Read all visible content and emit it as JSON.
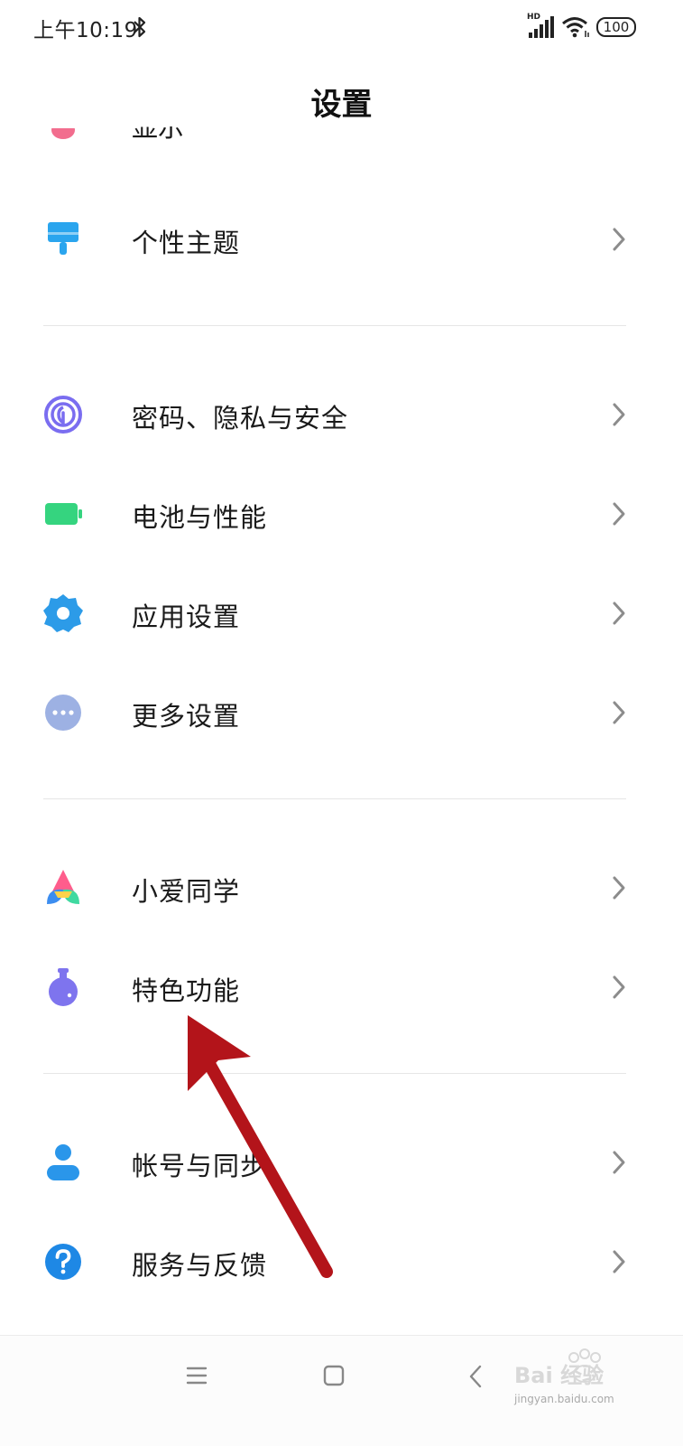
{
  "status_bar": {
    "time": "上午10:19",
    "network": "HD",
    "battery": "100"
  },
  "title": "设置",
  "partial_item": {
    "label": "显示"
  },
  "items": [
    {
      "label": "个性主题",
      "icon": "paintbrush-icon",
      "color": "#2aa5ee"
    },
    {
      "label": "密码、隐私与安全",
      "icon": "fingerprint-icon",
      "color": "#7a6df0"
    },
    {
      "label": "电池与性能",
      "icon": "battery-icon",
      "color": "#35d47f"
    },
    {
      "label": "应用设置",
      "icon": "gear-icon",
      "color": "#2c9be8"
    },
    {
      "label": "更多设置",
      "icon": "more-icon",
      "color": "#9db1e3"
    },
    {
      "label": "小爱同学",
      "icon": "xiaoai-icon",
      "color": "#ff5d8c"
    },
    {
      "label": "特色功能",
      "icon": "flask-icon",
      "color": "#7e74ee"
    },
    {
      "label": "帐号与同步",
      "icon": "account-icon",
      "color": "#2a96ea"
    },
    {
      "label": "服务与反馈",
      "icon": "help-icon",
      "color": "#1e88e5"
    }
  ],
  "watermark": {
    "text": "Bai 经验",
    "url": "jingyan.baidu.com"
  },
  "annotation_color": "#b3141a"
}
